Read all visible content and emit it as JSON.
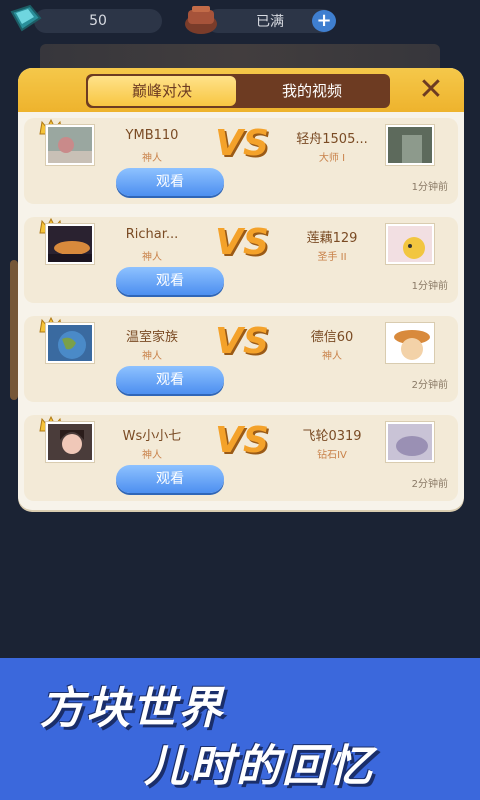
{
  "status": {
    "gems_value": "50",
    "energy_value": "已满",
    "plus_label": "+"
  },
  "dialog": {
    "tabs": [
      {
        "label": "巅峰对决",
        "active": true
      },
      {
        "label": "我的视频",
        "active": false
      }
    ],
    "close_label": "✕",
    "vs_label": "VS",
    "watch_label": "观看",
    "matches": [
      {
        "left_name": "YMB110",
        "left_rank": "神人",
        "right_name": "轻舟1505...",
        "right_rank": "大师 I",
        "time": "1分钟前"
      },
      {
        "left_name": "Richar...",
        "left_rank": "神人",
        "right_name": "莲藕129",
        "right_rank": "圣手 II",
        "time": "1分钟前"
      },
      {
        "left_name": "温室家族",
        "left_rank": "神人",
        "right_name": "德信60",
        "right_rank": "神人",
        "time": "2分钟前"
      },
      {
        "left_name": "Ws小小七",
        "left_rank": "神人",
        "right_name": "飞轮0319",
        "right_rank": "钻石IV",
        "time": "2分钟前"
      }
    ]
  },
  "promo": {
    "line1": "方块世界",
    "line2": "儿时的回忆"
  },
  "colors": {
    "background": "#1b2334",
    "dialog_bg": "#f7f3ea",
    "tab_active": "#f8c642",
    "tab_bar": "#6d3b22",
    "vs": "#f4a22a",
    "watch_button": "#4d8ff0",
    "promo_bg": "#3b68dc"
  }
}
